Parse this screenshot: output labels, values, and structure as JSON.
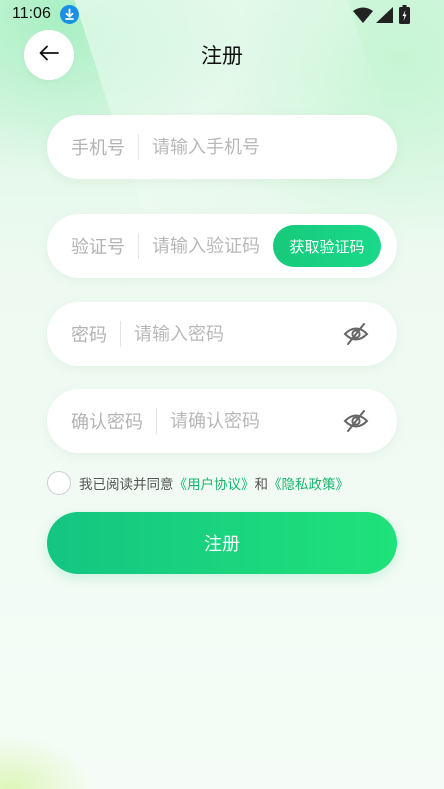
{
  "status_bar": {
    "time": "11:06"
  },
  "header": {
    "title": "注册"
  },
  "form": {
    "phone": {
      "label": "手机号",
      "placeholder": "请输入手机号",
      "value": ""
    },
    "code": {
      "label": "验证号",
      "placeholder": "请输入验证码",
      "value": "",
      "button_label": "获取验证码"
    },
    "password": {
      "label": "密码",
      "placeholder": "请输入密码",
      "value": ""
    },
    "confirm": {
      "label": "确认密码",
      "placeholder": "请确认密码",
      "value": ""
    }
  },
  "agreement": {
    "prefix": "我已阅读并同意",
    "user_agreement": "《用户协议》",
    "conjunction": "和",
    "privacy_policy": "《隐私政策》",
    "checked": false
  },
  "register_button": {
    "label": "注册"
  },
  "colors": {
    "accent": "#17c97b",
    "link": "#17b56e",
    "placeholder": "#b8b8b8"
  },
  "icons": [
    "download-icon",
    "wifi-icon",
    "signal-icon",
    "battery-icon",
    "arrow-left-icon",
    "eye-off-icon"
  ]
}
